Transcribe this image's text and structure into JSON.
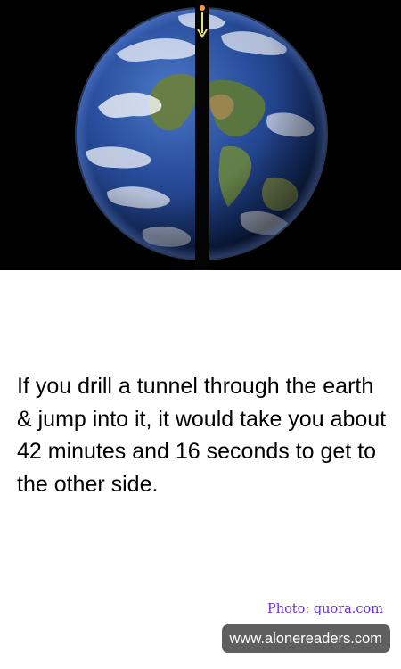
{
  "fact": {
    "text": "If you drill a tunnel through the earth & jump into it, it would take you about 42 minutes and 16 seconds to get to the other side."
  },
  "credits": {
    "photo": "Photo: quora.com",
    "site": "www.alonereaders.com"
  },
  "colors": {
    "background": "#ffffff",
    "hero_background": "#000000",
    "text": "#000000",
    "credit": "#6a2fd8",
    "badge_background": "#5f5f5f",
    "badge_text": "#ffffff",
    "arrow": "#e9e36a"
  },
  "icons": {
    "tunnel_arrow": "down-arrow-icon"
  }
}
